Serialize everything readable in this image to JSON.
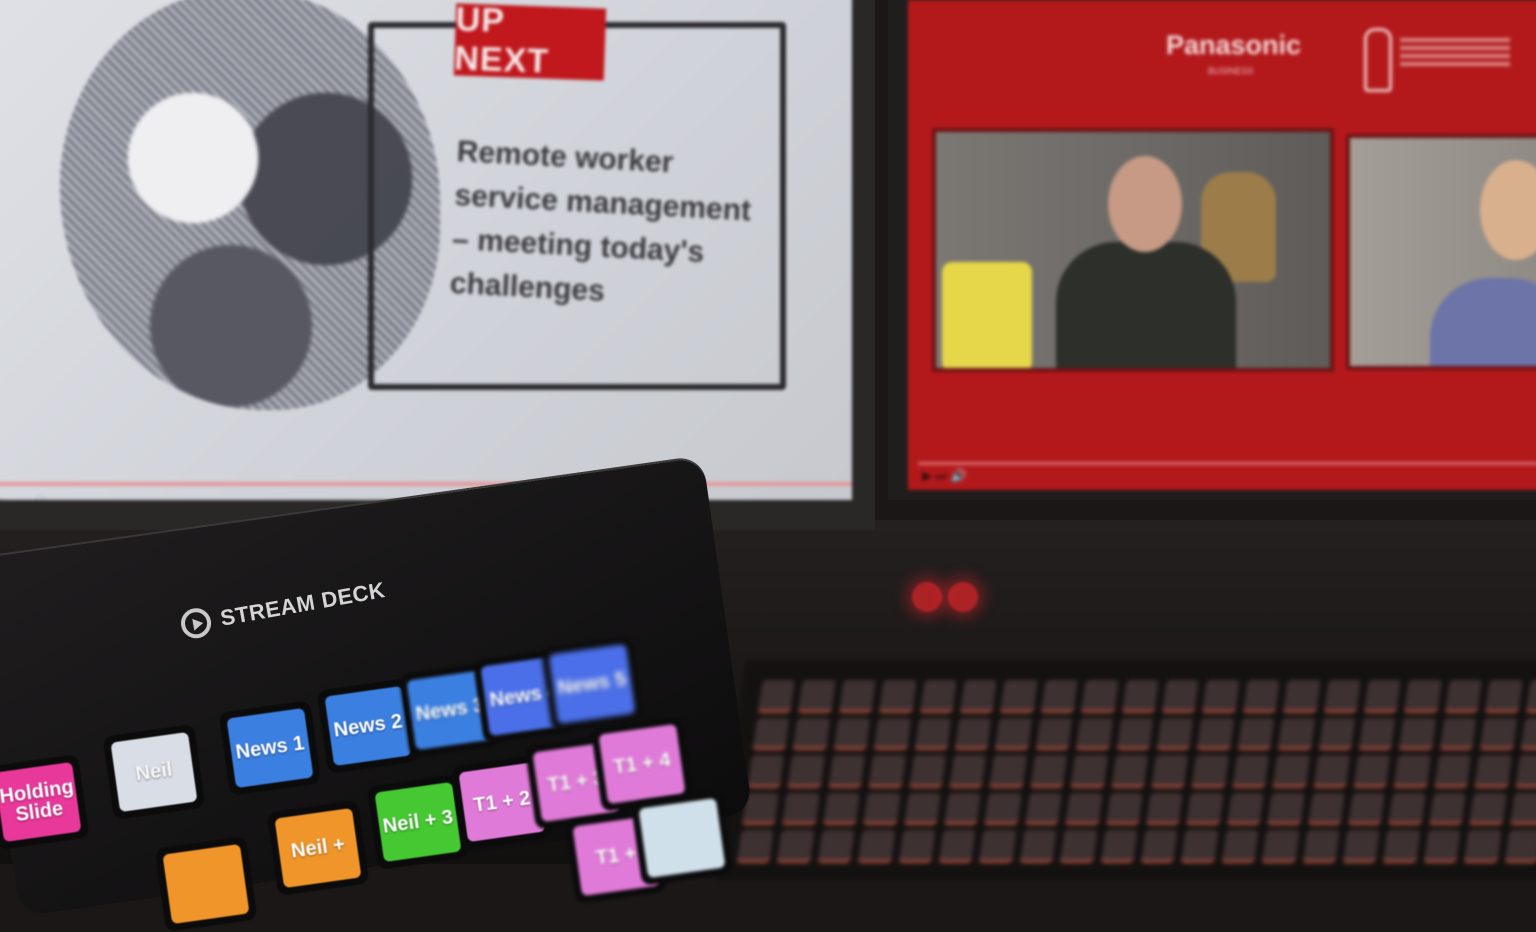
{
  "left_screen": {
    "badge": "UP NEXT",
    "title": "Remote worker service management – meeting today's challenges"
  },
  "right_screen": {
    "brand": "Panasonic",
    "brand_sub": "BUSINESS"
  },
  "stream_deck": {
    "brand": "STREAM DECK",
    "keys": [
      {
        "label": "Holding Slide",
        "color": "#e8389a"
      },
      {
        "label": "Neil",
        "color": "#d9dde6"
      },
      {
        "label": "News 1",
        "color": "#3b7fe0"
      },
      {
        "label": "News 2",
        "color": "#3b7fe0"
      },
      {
        "label": "News 3",
        "color": "#3b7fe0"
      },
      {
        "label": "News 4",
        "color": "#4a6fe8"
      },
      {
        "label": "News 5",
        "color": "#4a6fe8"
      },
      {
        "label": "Neil + 3",
        "color": "#46c832"
      },
      {
        "label": "T1 + 2",
        "color": "#e07ad8"
      },
      {
        "label": "T1 + 3",
        "color": "#e07ad8"
      },
      {
        "label": "T1 + 4",
        "color": "#e07ad8"
      },
      {
        "label": "Neil +",
        "color": "#f0952a"
      },
      {
        "label": "",
        "color": "#f0952a"
      },
      {
        "label": "T1 +",
        "color": "#e07ad8"
      },
      {
        "label": "",
        "color": "#cfe0ea"
      }
    ]
  },
  "colors": {
    "accent_red": "#c0181d",
    "deck_body": "#141213"
  }
}
